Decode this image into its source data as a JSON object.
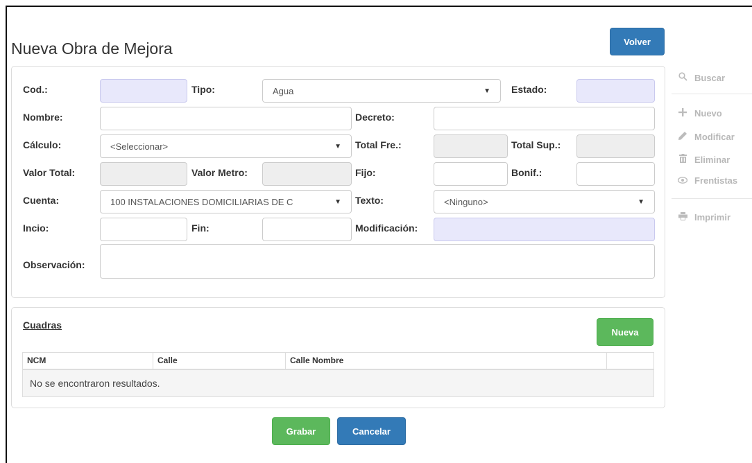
{
  "header": {
    "title": "Nueva Obra de Mejora",
    "back_label": "Volver"
  },
  "form": {
    "cod": {
      "label": "Cod.:",
      "value": ""
    },
    "tipo": {
      "label": "Tipo:",
      "value": "Agua"
    },
    "estado": {
      "label": "Estado:",
      "value": ""
    },
    "nombre": {
      "label": "Nombre:",
      "value": ""
    },
    "decreto": {
      "label": "Decreto:",
      "value": ""
    },
    "calculo": {
      "label": "Cálculo:",
      "value": "<Seleccionar>"
    },
    "total_fre": {
      "label": "Total Fre.:",
      "value": ""
    },
    "total_sup": {
      "label": "Total Sup.:",
      "value": ""
    },
    "valor_total": {
      "label": "Valor Total:",
      "value": ""
    },
    "valor_metro": {
      "label": "Valor Metro:",
      "value": ""
    },
    "fijo": {
      "label": "Fijo:",
      "value": ""
    },
    "bonif": {
      "label": "Bonif.:",
      "value": ""
    },
    "cuenta": {
      "label": "Cuenta:",
      "value": "100 INSTALACIONES DOMICILIARIAS DE C"
    },
    "texto": {
      "label": "Texto:",
      "value": "<Ninguno>"
    },
    "inicio": {
      "label": "Incio:",
      "value": ""
    },
    "fin": {
      "label": "Fin:",
      "value": ""
    },
    "modificacion": {
      "label": "Modificación:",
      "value": ""
    },
    "observacion": {
      "label": "Observación:",
      "value": ""
    }
  },
  "cuadras": {
    "title": "Cuadras",
    "new_label": "Nueva",
    "columns": [
      "NCM",
      "Calle",
      "Calle Nombre",
      ""
    ],
    "empty_message": "No se encontraron resultados."
  },
  "footer": {
    "save_label": "Grabar",
    "cancel_label": "Cancelar"
  },
  "sidebar": {
    "items": [
      {
        "label": "Buscar",
        "icon": "search-icon"
      },
      {
        "label": "Nuevo",
        "icon": "plus-icon"
      },
      {
        "label": "Modificar",
        "icon": "pencil-icon"
      },
      {
        "label": "Eliminar",
        "icon": "trash-icon"
      },
      {
        "label": "Frentistas",
        "icon": "eye-icon"
      },
      {
        "label": "Imprimir",
        "icon": "print-icon"
      }
    ]
  },
  "colors": {
    "primary": "#337ab7",
    "success": "#5cb85c",
    "highlight_input": "#e8e8fb",
    "readonly_input": "#eeeeee"
  }
}
